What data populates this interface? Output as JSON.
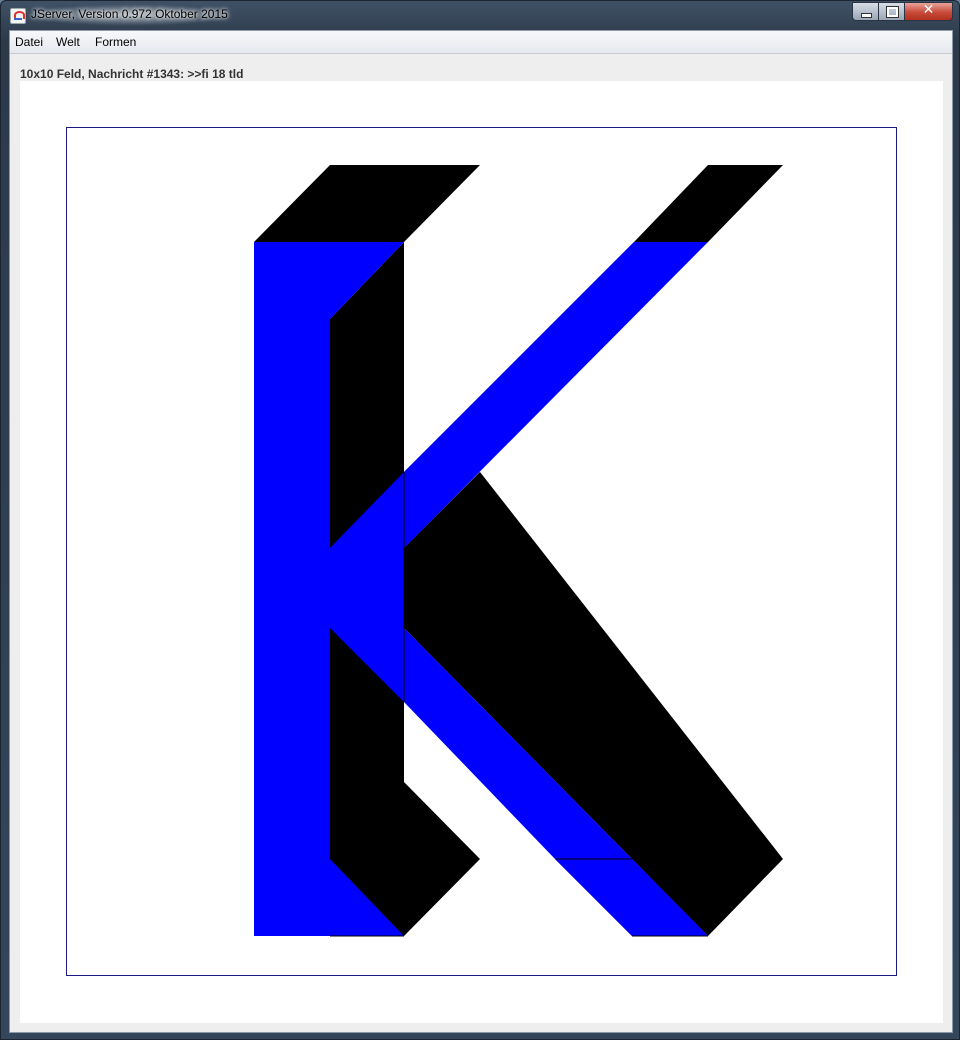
{
  "window": {
    "title": "JServer, Version 0.972 Oktober 2015",
    "icon": "java-cup-icon"
  },
  "menu": {
    "items": [
      "Datei",
      "Welt",
      "Formen"
    ]
  },
  "status": {
    "message": "10x10 Feld, Nachricht #1343: >>fi 18 tld"
  },
  "canvas": {
    "shape": "letter K, extruded",
    "colors": {
      "front": "#0000ff",
      "shadow": "#000000",
      "background": "#ffffff",
      "frame": "#1a1a80"
    }
  }
}
